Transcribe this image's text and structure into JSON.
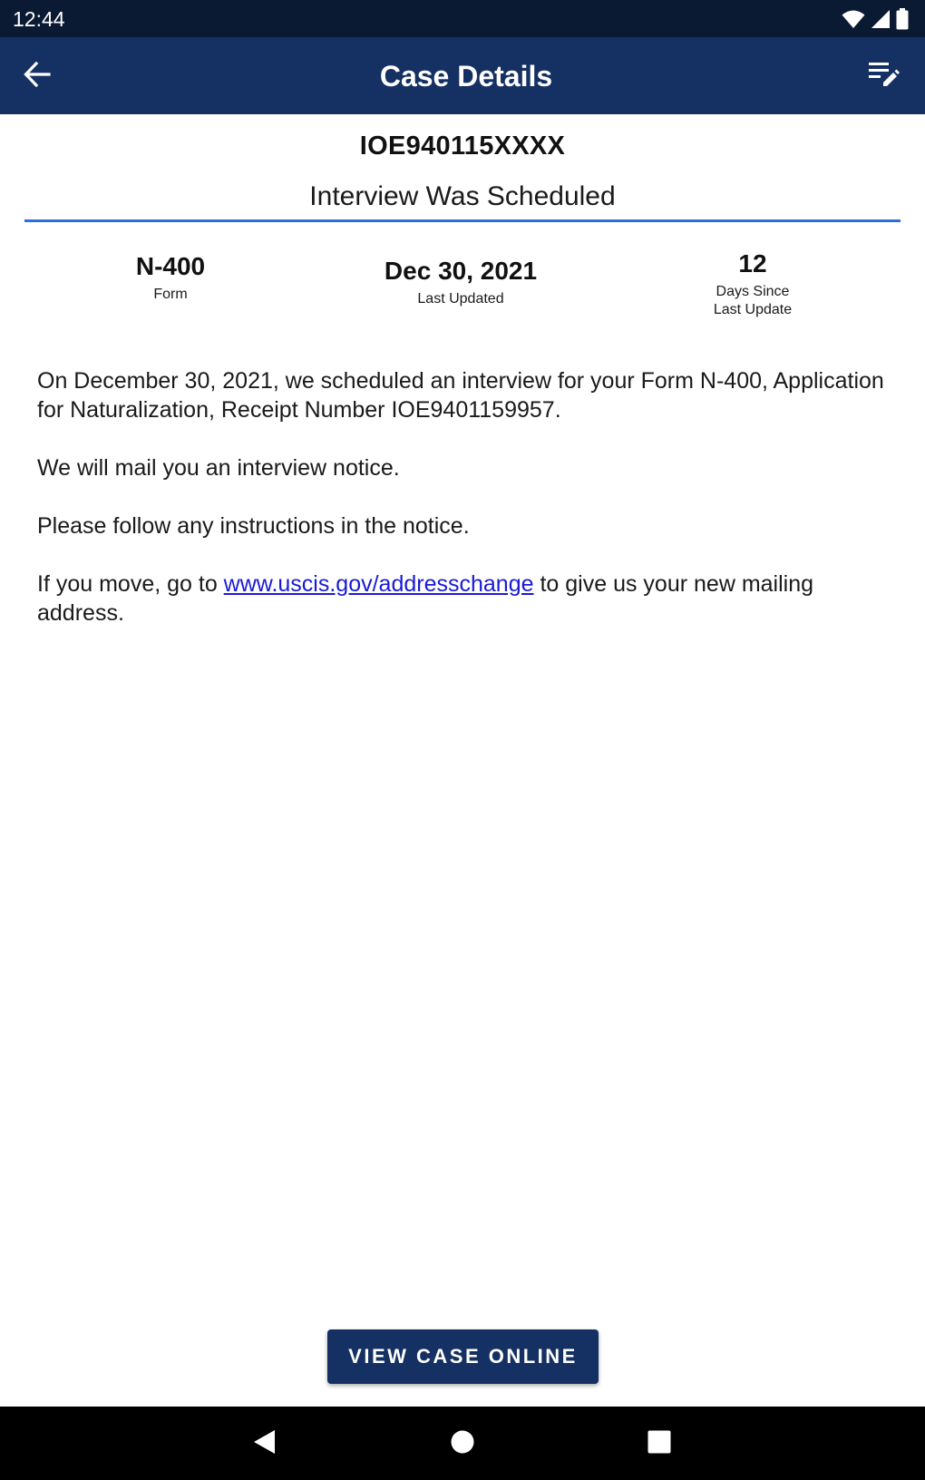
{
  "status_bar": {
    "time": "12:44",
    "icons": [
      "wifi-icon",
      "cell-signal-icon",
      "battery-icon"
    ]
  },
  "app_bar": {
    "title": "Case Details",
    "back_icon": "arrow-back-icon",
    "action_icon": "edit-notes-icon"
  },
  "case": {
    "receipt_number": "IOE940115XXXX",
    "status_title": "Interview Was Scheduled",
    "stats": {
      "form_value": "N-400",
      "form_label": "Form",
      "updated_value": "Dec 30, 2021",
      "updated_label": "Last Updated",
      "days_value": "12",
      "days_label_line1": "Days Since",
      "days_label_line2": "Last Update"
    },
    "body": {
      "paragraph1": "On December 30, 2021, we scheduled an interview for your Form N-400, Application for Naturalization, Receipt Number IOE9401159957.",
      "paragraph2": "We will mail you an interview notice.",
      "paragraph3": "Please follow any instructions in the notice.",
      "paragraph4_prefix": "If you move, go to ",
      "paragraph4_link": "www.uscis.gov/addresschange",
      "paragraph4_suffix": " to give us your new mailing address."
    }
  },
  "actions": {
    "view_online_label": "VIEW CASE ONLINE"
  },
  "nav_bar": {
    "icons": [
      "nav-back-icon",
      "nav-home-icon",
      "nav-recents-icon"
    ]
  },
  "colors": {
    "status_bar_bg": "#0b1a33",
    "app_bar_bg": "#153062",
    "accent_divider": "#2a6fdb",
    "link": "#1a1ad6",
    "button_bg": "#153062"
  }
}
